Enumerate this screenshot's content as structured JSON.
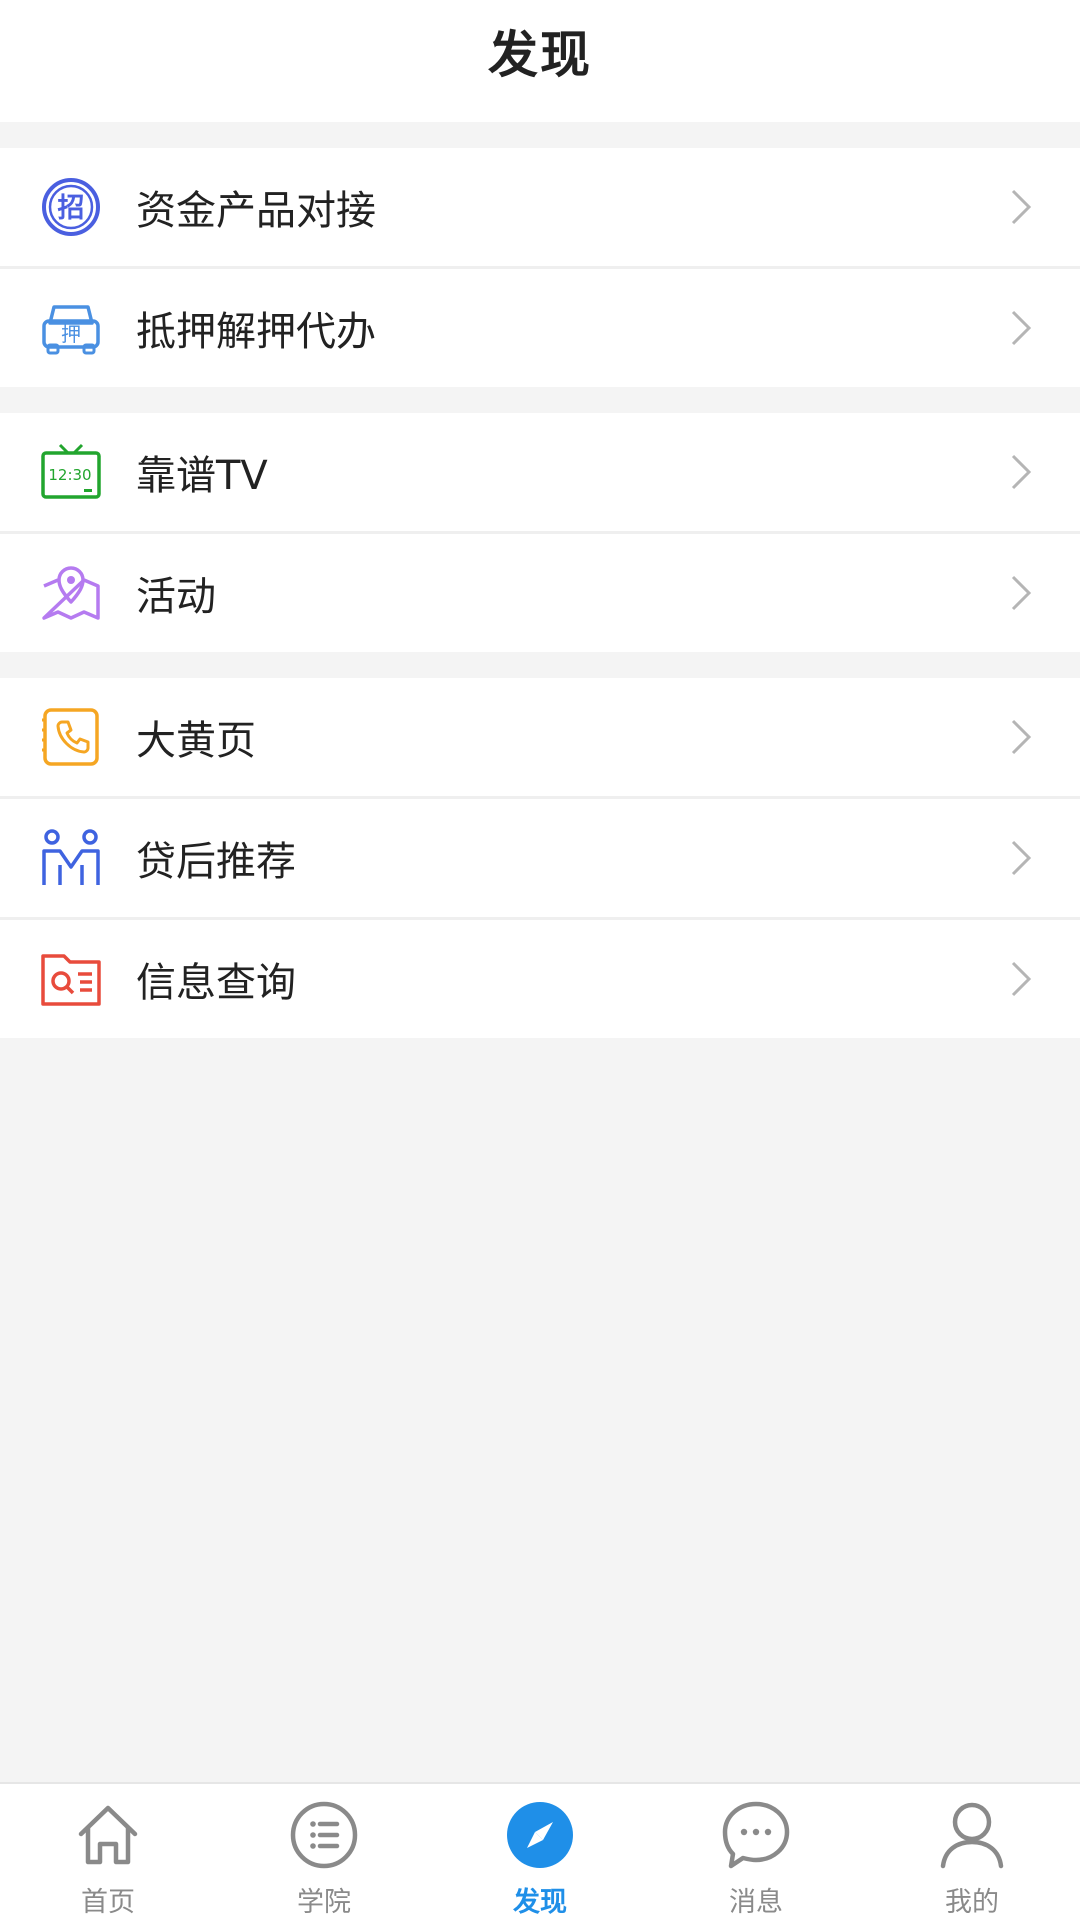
{
  "header": {
    "title": "发现"
  },
  "groups": [
    {
      "items": [
        {
          "label": "资金产品对接",
          "icon": "zhao-badge-icon"
        },
        {
          "label": "抵押解押代办",
          "icon": "car-mortgage-icon"
        }
      ]
    },
    {
      "items": [
        {
          "label": "靠谱TV",
          "icon": "tv-icon",
          "icon_text": "12:30"
        },
        {
          "label": "活动",
          "icon": "map-pin-icon"
        }
      ]
    },
    {
      "items": [
        {
          "label": "大黄页",
          "icon": "phone-book-icon"
        },
        {
          "label": "贷后推荐",
          "icon": "people-icon"
        },
        {
          "label": "信息查询",
          "icon": "folder-search-icon"
        }
      ]
    }
  ],
  "tabs": [
    {
      "label": "首页",
      "icon": "home-icon",
      "active": false
    },
    {
      "label": "学院",
      "icon": "list-icon",
      "active": false
    },
    {
      "label": "发现",
      "icon": "compass-icon",
      "active": true
    },
    {
      "label": "消息",
      "icon": "chat-icon",
      "active": false
    },
    {
      "label": "我的",
      "icon": "user-icon",
      "active": false
    }
  ],
  "colors": {
    "accent": "#1f8fe8",
    "background": "#f4f4f4",
    "zhao_icon": "#4a5fe0",
    "car_icon": "#4a90e2",
    "tv_icon": "#22a52e",
    "activity_icon": "#b57bf0",
    "phone_icon": "#f5a623",
    "people_icon": "#3f63e0",
    "info_icon": "#e84b3c"
  }
}
